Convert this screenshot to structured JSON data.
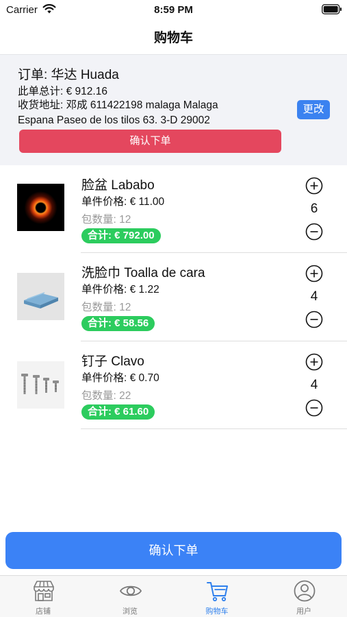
{
  "status_bar": {
    "carrier": "Carrier",
    "time": "8:59 PM"
  },
  "nav": {
    "title": "购物车"
  },
  "order": {
    "title": "订单: 华达 Huada",
    "total": "此单总计: € 912.16",
    "address": "收货地址: 邓成 611422198 malaga Malaga Espana Paseo de los tilos 63. 3-D 29002",
    "change_label": "更改",
    "confirm_label": "确认下单"
  },
  "items": [
    {
      "name": "脸盆 Lababo",
      "unit_price": "单件价格: € 11.00",
      "pack": "包数量: 12",
      "subtotal": "合计: € 792.00",
      "quantity": "6",
      "image_icon": "black-hole-image"
    },
    {
      "name": "洗脸巾 Toalla de cara",
      "unit_price": "单件价格: € 1.22",
      "pack": "包数量: 12",
      "subtotal": "合计: € 58.56",
      "quantity": "4",
      "image_icon": "towel-image"
    },
    {
      "name": "钉子 Clavo",
      "unit_price": "单件价格: € 0.70",
      "pack": "包数量: 22",
      "subtotal": "合计: € 61.60",
      "quantity": "4",
      "image_icon": "screws-image"
    }
  ],
  "bottom": {
    "confirm_label": "确认下单"
  },
  "tabs": [
    {
      "label": "店铺",
      "icon": "store-icon",
      "active": false
    },
    {
      "label": "浏览",
      "icon": "eye-icon",
      "active": false
    },
    {
      "label": "购物车",
      "icon": "cart-icon",
      "active": true
    },
    {
      "label": "用户",
      "icon": "user-icon",
      "active": false
    }
  ],
  "colors": {
    "accent": "#2f80ed",
    "danger": "#e4475e",
    "success": "#2ccc5e",
    "primary_button": "#3b82f6"
  }
}
